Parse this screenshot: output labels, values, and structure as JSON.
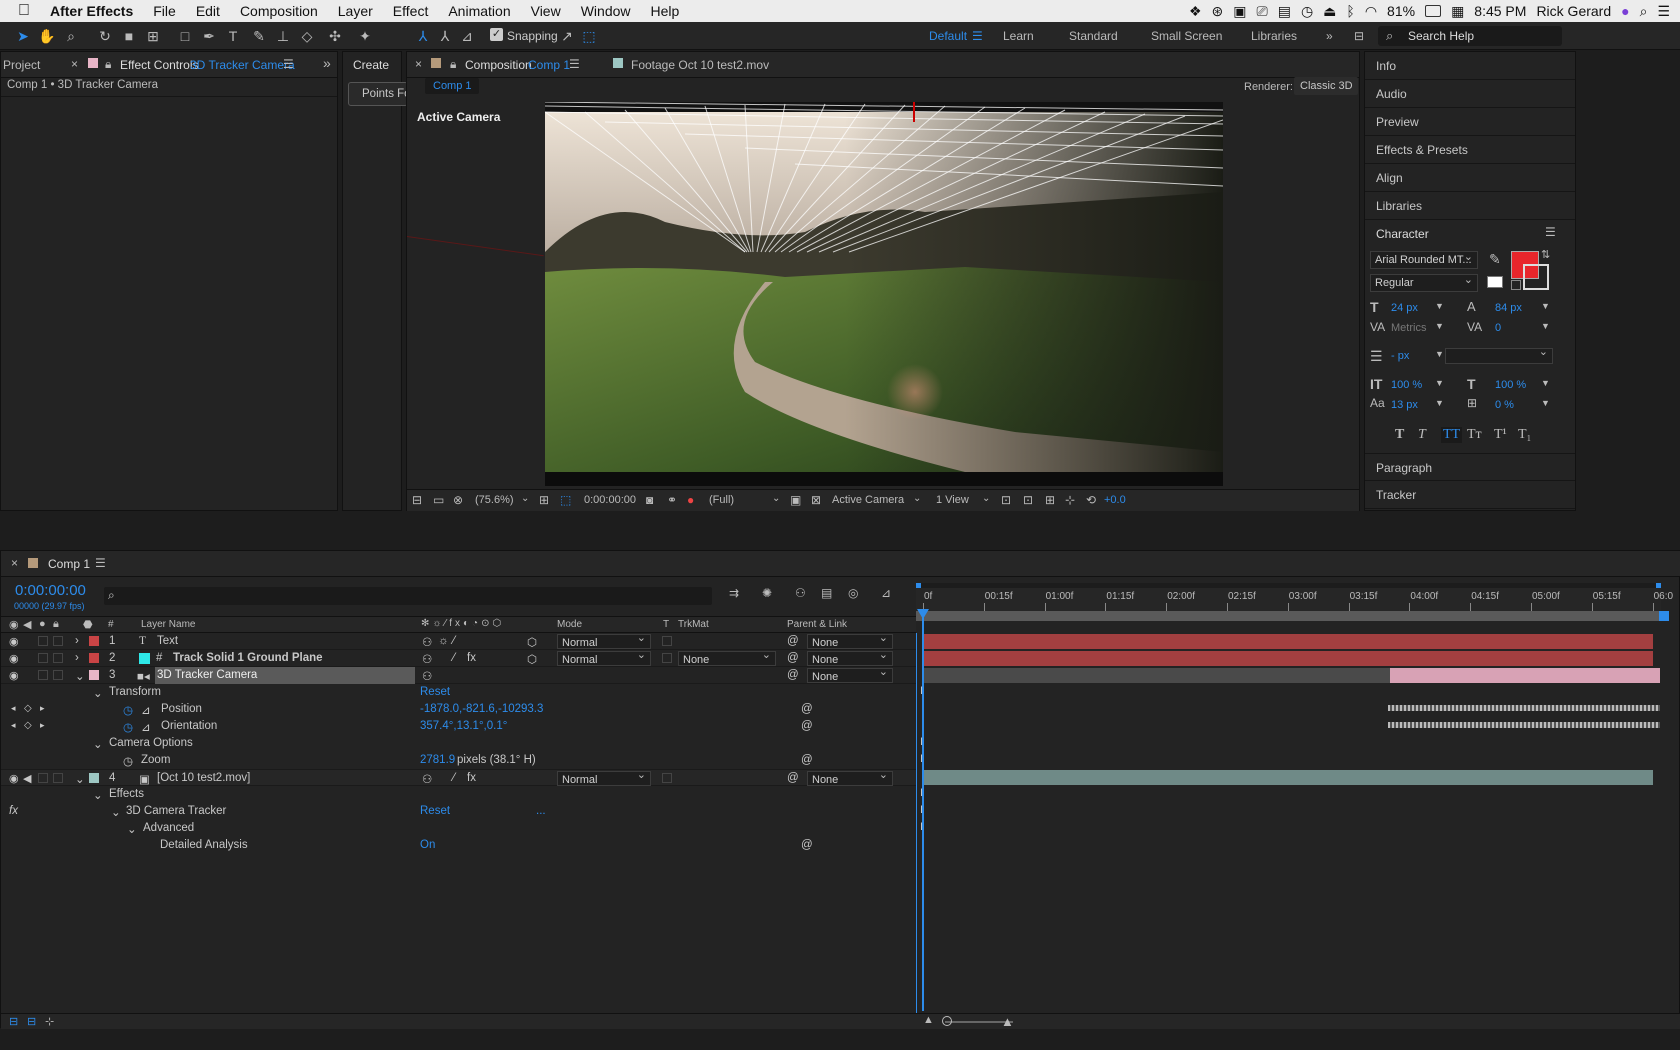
{
  "menubar": {
    "app": "After Effects",
    "items": [
      "File",
      "Edit",
      "Composition",
      "Layer",
      "Effect",
      "Animation",
      "View",
      "Window",
      "Help"
    ],
    "battery": "81%",
    "time": "8:45 PM",
    "user": "Rick Gerard"
  },
  "toolbar": {
    "snapping_label": "Snapping",
    "workspaces": [
      "Default",
      "Learn",
      "Standard",
      "Small Screen",
      "Libraries"
    ],
    "active_workspace": "Default",
    "search_placeholder": "Search Help"
  },
  "left_panel": {
    "tab_project": "Project",
    "tab_effect_controls_prefix": "Effect Controls",
    "tab_effect_controls_layer": "3D Tracker Camera",
    "breadcrumb": "Comp 1 • 3D Tracker Camera",
    "create_tab": "Create",
    "points_button": "Points Fo"
  },
  "viewer": {
    "tab_composition_prefix": "Composition",
    "tab_composition_name": "Comp 1",
    "tab_footage": "Footage Oct 10 test2.mov",
    "subtab": "Comp 1",
    "renderer_label": "Renderer:",
    "renderer_value": "Classic 3D",
    "active_camera_label": "Active Camera",
    "zoom": "(75.6%)",
    "timecode": "0:00:00:00",
    "resolution": "(Full)",
    "camera_view": "Active Camera",
    "views": "1 View",
    "exposure": "+0.0"
  },
  "right_panel": {
    "items": [
      "Info",
      "Audio",
      "Preview",
      "Effects & Presets",
      "Align",
      "Libraries"
    ],
    "character_title": "Character",
    "font_family": "Arial Rounded MT...",
    "font_style": "Regular",
    "font_size": "24 px",
    "leading": "84 px",
    "kerning": "Metrics",
    "tracking": "0",
    "stroke_width": "- px",
    "vscale": "100 %",
    "hscale": "100 %",
    "baseline": "13 px",
    "tsume": "0 %",
    "style_buttons": [
      "T",
      "T",
      "TT",
      "Tт",
      "T¹",
      "T₁"
    ],
    "paragraph": "Paragraph",
    "tracker": "Tracker",
    "fill_color": "#e8262b"
  },
  "timeline": {
    "tab": "Comp 1",
    "timecode": "0:00:00:00",
    "frames": "00000 (29.97 fps)",
    "search_placeholder": "",
    "col_hash": "#",
    "col_layer_name": "Layer Name",
    "col_mode": "Mode",
    "col_t": "T",
    "col_trkmat": "TrkMat",
    "col_parent": "Parent & Link",
    "ruler": [
      "0f",
      "00:15f",
      "01:00f",
      "01:15f",
      "02:00f",
      "02:15f",
      "03:00f",
      "03:15f",
      "04:00f",
      "04:15f",
      "05:00f",
      "05:15f",
      "06:0"
    ],
    "layers": [
      {
        "num": "1",
        "name": "Text",
        "mode": "Normal",
        "trkmat": "",
        "parent": "None",
        "label": "#c94445"
      },
      {
        "num": "2",
        "name": "Track Solid 1 Ground Plane",
        "mode": "Normal",
        "trkmat": "None",
        "parent": "None",
        "label": "#c94445"
      },
      {
        "num": "3",
        "name": "3D Tracker Camera",
        "mode": "",
        "trkmat": "",
        "parent": "None",
        "label": "#e8b5c7"
      },
      {
        "num": "4",
        "name": "[Oct 10 test2.mov]",
        "mode": "Normal",
        "trkmat": "",
        "parent": "None",
        "label": "#9dc7c3"
      }
    ],
    "props": {
      "transform": "Transform",
      "transform_reset": "Reset",
      "position": "Position",
      "position_value": "-1878.0,-821.6,-10293.3",
      "orientation": "Orientation",
      "orientation_value": "357.4°,13.1°,0.1°",
      "camera_options": "Camera Options",
      "zoom": "Zoom",
      "zoom_value": "2781.9",
      "zoom_unit": "pixels (38.1° H)",
      "effects": "Effects",
      "tracker": "3D Camera Tracker",
      "tracker_reset": "Reset",
      "tracker_more": "...",
      "advanced": "Advanced",
      "detailed": "Detailed Analysis",
      "detailed_value": "On"
    }
  }
}
